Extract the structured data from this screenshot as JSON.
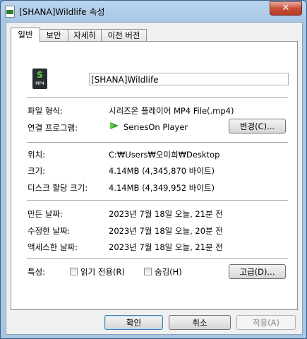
{
  "window": {
    "title": "[SHANA]Wildlife 속성",
    "close_glyph": "✕"
  },
  "tabs": [
    {
      "label": "일반",
      "active": true
    },
    {
      "label": "보안",
      "active": false
    },
    {
      "label": "자세히",
      "active": false
    },
    {
      "label": "이전 버전",
      "active": false
    }
  ],
  "file": {
    "icon_letter": "S",
    "icon_text": "MP4",
    "name": "[SHANA]Wildlife"
  },
  "info": {
    "file_type_label": "파일 형식:",
    "file_type_value": "시리즈온 플레이어 MP4 File(.mp4)",
    "open_with_label": "연결 프로그램:",
    "open_with_value": "SeriesOn Player",
    "change_button": "변경(C)...",
    "location_label": "위치:",
    "location_value": "C:₩Users₩오미희₩Desktop",
    "size_label": "크기:",
    "size_value": "4.14MB (4,345,870 바이트)",
    "disk_size_label": "디스크 할당 크기:",
    "disk_size_value": "4.14MB (4,349,952 바이트)",
    "created_label": "만든 날짜:",
    "created_value": "2023년 7월 18일 오늘, 21분 전",
    "modified_label": "수정한 날짜:",
    "modified_value": "2023년 7월 18일 오늘, 20분 전",
    "accessed_label": "액세스한 날짜:",
    "accessed_value": "2023년 7월 18일 오늘, 21분 전",
    "attributes_label": "특성:",
    "readonly_label": "읽기 전용(R)",
    "hidden_label": "숨김(H)",
    "advanced_button": "고급(D)..."
  },
  "footer": {
    "ok": "확인",
    "cancel": "취소",
    "apply": "적용(A)"
  },
  "colors": {
    "app_accent": "#2e9a3a"
  }
}
